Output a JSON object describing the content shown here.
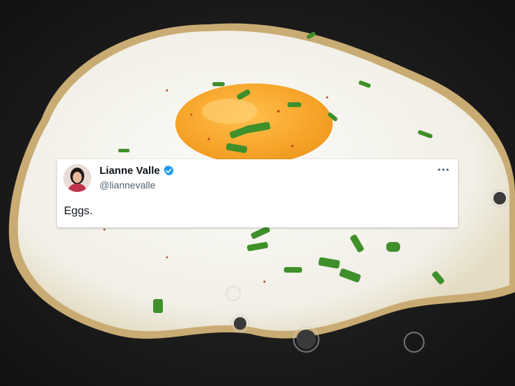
{
  "tweet": {
    "display_name": "Lianne Valle",
    "handle": "@liannevalle",
    "text": "Eggs.",
    "verified": true,
    "avatar_icon": "profile-photo",
    "more_icon": "more-horizontal-icon"
  },
  "colors": {
    "verified": "#1d9bf0",
    "name": "#0f1419",
    "handle": "#536471",
    "card_bg": "#ffffff"
  }
}
